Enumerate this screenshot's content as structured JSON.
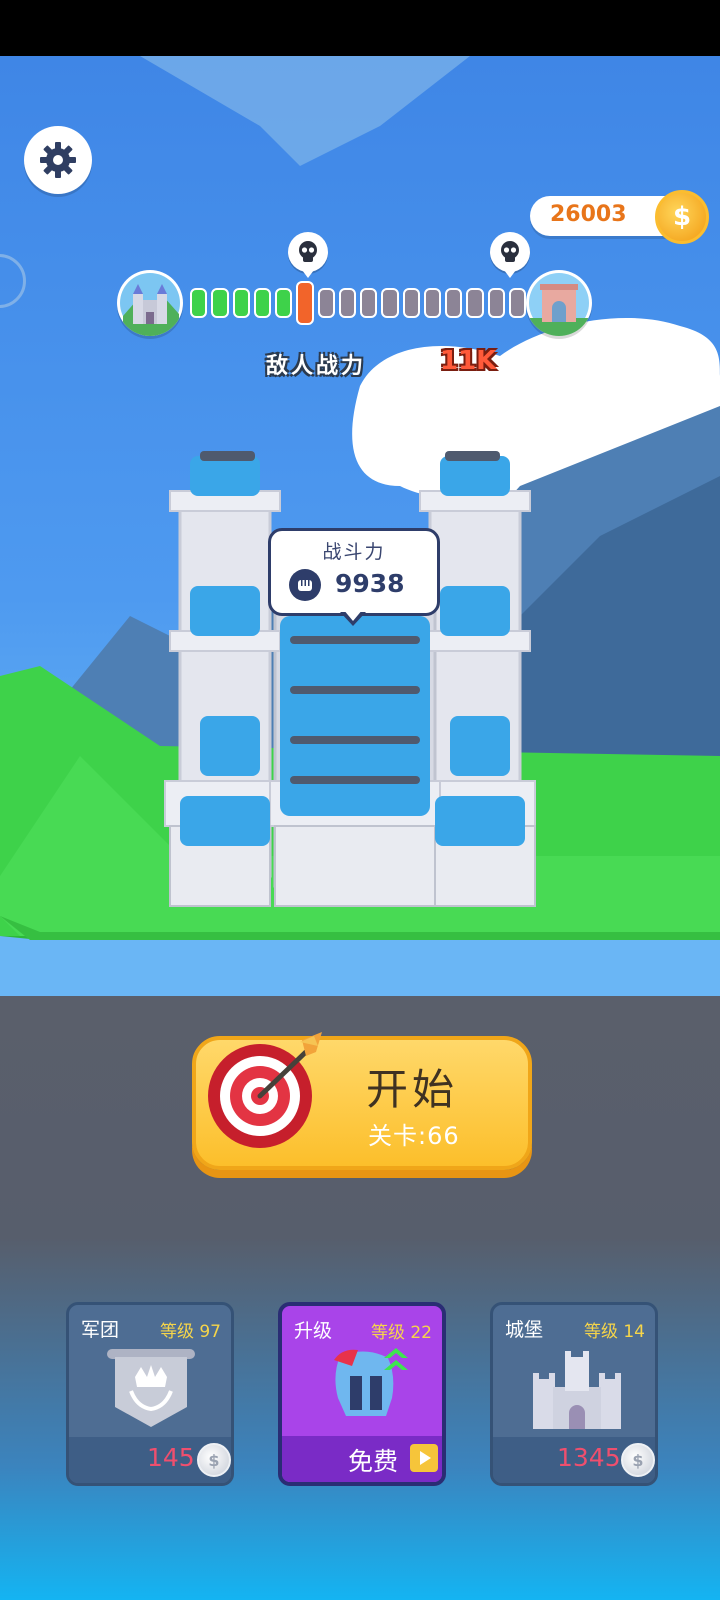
{
  "hud": {
    "coins": "26003",
    "coin_symbol": "$",
    "enemy_power_label": "敌人战力",
    "enemy_power_value": "11K"
  },
  "progress": {
    "total_segments": 16,
    "completed_segments": 5,
    "current_segment": 6
  },
  "power_bubble": {
    "title": "战斗力",
    "value": "9938"
  },
  "start_button": {
    "label": "开始",
    "stage_text": "关卡:66"
  },
  "cards": [
    {
      "title": "军团",
      "level_text": "等级 97",
      "price": "145",
      "icon": "legion-crown-banner-icon"
    },
    {
      "title": "升级",
      "level_text": "等级 22",
      "price": "免费",
      "icon": "helmet-upgrade-icon"
    },
    {
      "title": "城堡",
      "level_text": "等级 14",
      "price": "1345",
      "icon": "castle-icon"
    }
  ],
  "colors": {
    "sky": "#4e9af0",
    "grass": "#3ed24a",
    "start_button": "#fcbf2b",
    "card_grey": "#4e6d93",
    "card_purple": "#a944e9",
    "price_red": "#ef4f6e",
    "level_yellow": "#f6d54a"
  }
}
